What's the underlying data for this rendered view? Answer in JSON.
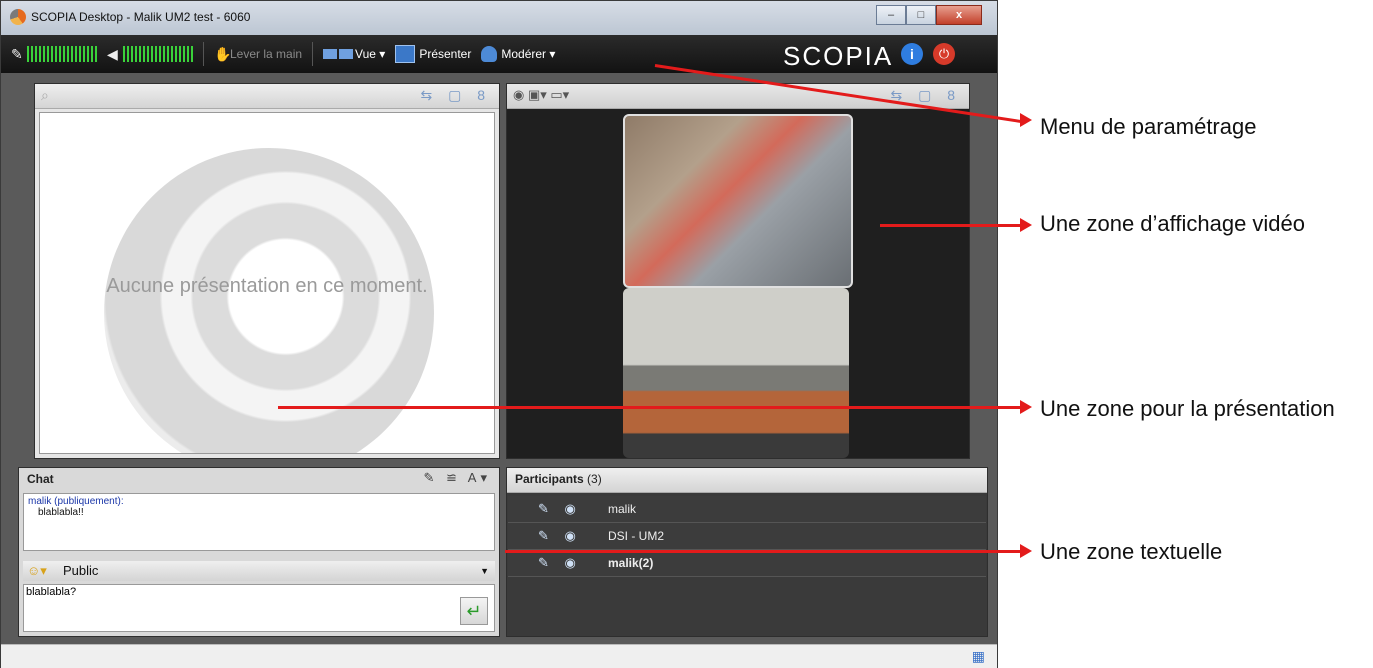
{
  "window": {
    "title": "SCOPIA Desktop - Malik UM2 test - 6060",
    "minimize": "–",
    "maximize": "□",
    "close": "x"
  },
  "toolbar": {
    "raise_hand": "Lever la main",
    "view": "Vue ▾",
    "present": "Présenter",
    "moderate": "Modérer ▾",
    "logo": "SCOPIA",
    "info": "i",
    "power": "⏻"
  },
  "presentation": {
    "empty_text": "Aucune présentation en ce moment.",
    "toolbar_icons": "⇆ ▢ 8"
  },
  "video": {
    "toolbar_icons": "⇆ ▢ 8",
    "left_icons": "◉ ▣▾ ▭▾"
  },
  "chat": {
    "title": "Chat",
    "sender": "malik (publiquement):",
    "message": "blablabla!!",
    "channel": "Public",
    "input_value": "blablabla?",
    "send_icon": "↵",
    "head_icons": "✎ ≌ A▾"
  },
  "participants": {
    "title": "Participants",
    "count": "(3)",
    "list": [
      {
        "name": "malik"
      },
      {
        "name": "DSI - UM2"
      },
      {
        "name": "malik(2)"
      }
    ]
  },
  "annotations": {
    "menu": "Menu de paramétrage",
    "video": "Une zone d’affichage vidéo",
    "presentation": "Une zone pour la présentation",
    "text": "Une zone textuelle"
  },
  "colors": {
    "accent": "#e31b1b",
    "toolbar": "#1a1a1a"
  }
}
